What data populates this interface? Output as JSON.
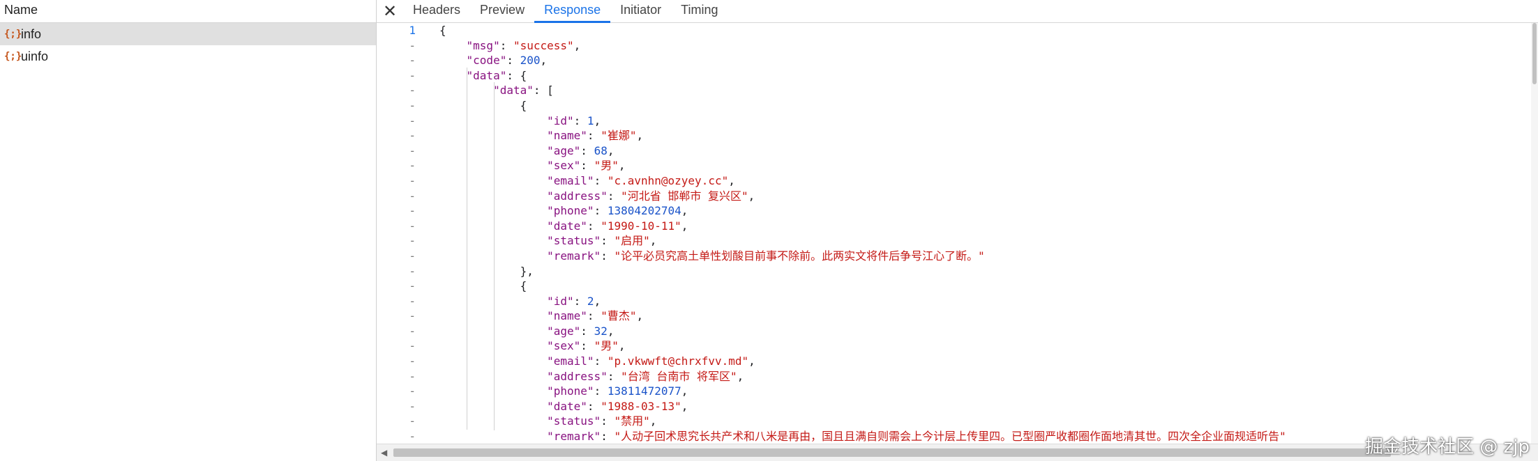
{
  "left_panel": {
    "header": "Name",
    "requests": [
      {
        "icon": "{;}",
        "name": "info",
        "selected": true
      },
      {
        "icon": "{;}",
        "name": "uinfo",
        "selected": false
      }
    ]
  },
  "tabs": {
    "close": "✕",
    "items": [
      "Headers",
      "Preview",
      "Response",
      "Initiator",
      "Timing"
    ],
    "active": "Response"
  },
  "response_lines": [
    {
      "g": "1",
      "t": "{"
    },
    {
      "g": "-",
      "t": "    \"msg\": \"success\","
    },
    {
      "g": "-",
      "t": "    \"code\": 200,"
    },
    {
      "g": "-",
      "t": "    \"data\": {"
    },
    {
      "g": "-",
      "t": "        \"data\": ["
    },
    {
      "g": "-",
      "t": "            {"
    },
    {
      "g": "-",
      "t": "                \"id\": 1,"
    },
    {
      "g": "-",
      "t": "                \"name\": \"崔娜\","
    },
    {
      "g": "-",
      "t": "                \"age\": 68,"
    },
    {
      "g": "-",
      "t": "                \"sex\": \"男\","
    },
    {
      "g": "-",
      "t": "                \"email\": \"c.avnhn@ozyey.cc\","
    },
    {
      "g": "-",
      "t": "                \"address\": \"河北省 邯郸市 复兴区\","
    },
    {
      "g": "-",
      "t": "                \"phone\": 13804202704,"
    },
    {
      "g": "-",
      "t": "                \"date\": \"1990-10-11\","
    },
    {
      "g": "-",
      "t": "                \"status\": \"启用\","
    },
    {
      "g": "-",
      "t": "                \"remark\": \"论平必员究高土单性划酸目前事不除前。此两实文将件后争号江心了断。\""
    },
    {
      "g": "-",
      "t": "            },"
    },
    {
      "g": "-",
      "t": "            {"
    },
    {
      "g": "-",
      "t": "                \"id\": 2,"
    },
    {
      "g": "-",
      "t": "                \"name\": \"曹杰\","
    },
    {
      "g": "-",
      "t": "                \"age\": 32,"
    },
    {
      "g": "-",
      "t": "                \"sex\": \"男\","
    },
    {
      "g": "-",
      "t": "                \"email\": \"p.vkwwft@chrxfvv.md\","
    },
    {
      "g": "-",
      "t": "                \"address\": \"台湾 台南市 将军区\","
    },
    {
      "g": "-",
      "t": "                \"phone\": 13811472077,"
    },
    {
      "g": "-",
      "t": "                \"date\": \"1988-03-13\","
    },
    {
      "g": "-",
      "t": "                \"status\": \"禁用\","
    },
    {
      "g": "-",
      "t": "                \"remark\": \"人动子回术思究长共产术和八米是再由，国且且满自则需会上今计层上传里四。已型圈严收都圈作面地清其世。四次全企业面规适听告\""
    }
  ],
  "watermark": "掘金技术社区 @ zjp",
  "colors": {
    "key": "#881280",
    "string": "#c41a16",
    "number": "#1a53c9",
    "accent": "#1a73e8"
  }
}
